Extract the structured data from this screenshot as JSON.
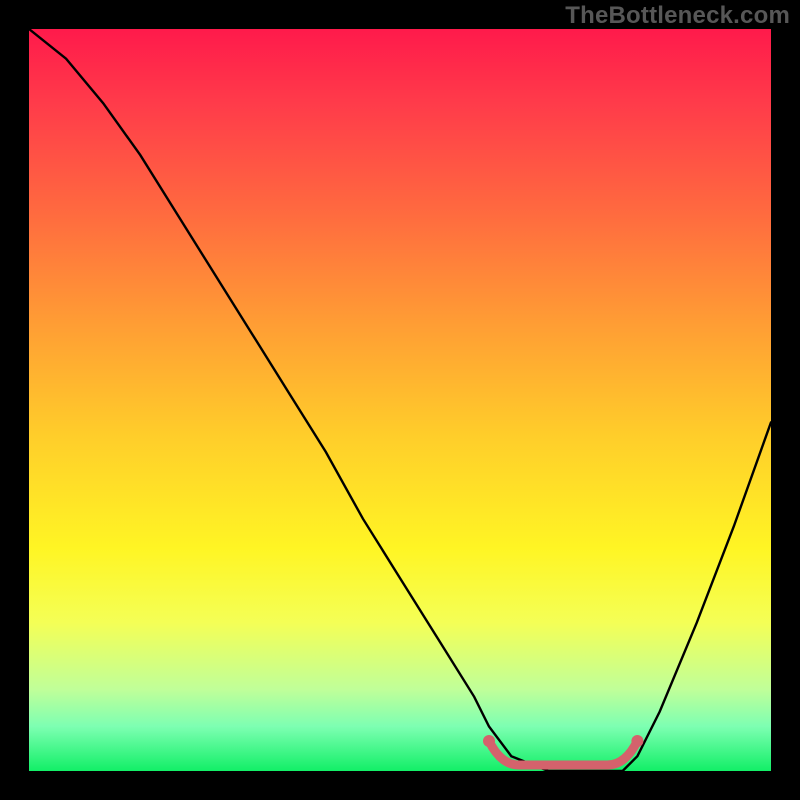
{
  "watermark": "TheBottleneck.com",
  "colors": {
    "background": "#000000",
    "gradient_top": "#ff1a4b",
    "gradient_bottom": "#12ef67",
    "curve": "#000000",
    "floor_segment": "#d4626c"
  },
  "chart_data": {
    "type": "line",
    "title": "",
    "xlabel": "",
    "ylabel": "",
    "xlim": [
      0,
      100
    ],
    "ylim": [
      0,
      100
    ],
    "grid": false,
    "series": [
      {
        "name": "bottleneck-curve",
        "x": [
          0,
          5,
          10,
          15,
          20,
          25,
          30,
          35,
          40,
          45,
          50,
          55,
          60,
          62,
          65,
          70,
          75,
          80,
          82,
          85,
          90,
          95,
          100
        ],
        "y": [
          100,
          96,
          90,
          83,
          75,
          67,
          59,
          51,
          43,
          34,
          26,
          18,
          10,
          6,
          2,
          0,
          0,
          0,
          2,
          8,
          20,
          33,
          47
        ]
      }
    ],
    "annotations": [
      {
        "name": "floor-segment",
        "x_range": [
          62,
          82
        ],
        "y": 0,
        "style": "thick-pink-dotted-ends"
      }
    ]
  }
}
